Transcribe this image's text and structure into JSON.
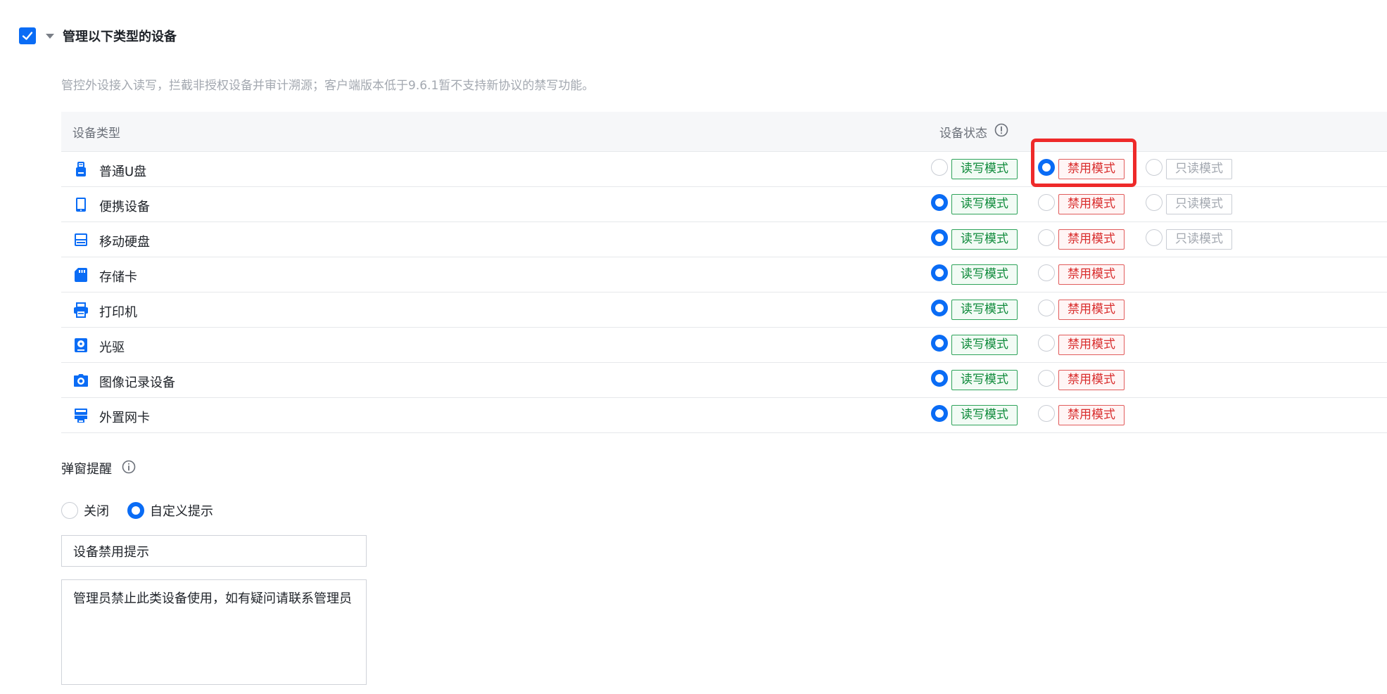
{
  "header": {
    "checked": true,
    "title": "管理以下类型的设备"
  },
  "description": "管控外设接入读写，拦截非授权设备并审计溯源；客户端版本低于9.6.1暂不支持新协议的禁写功能。",
  "table": {
    "col_type": "设备类型",
    "col_status": "设备状态",
    "status_info_icon": "exclamation-circle-icon",
    "mode_labels": {
      "read_write": "读写模式",
      "disabled": "禁用模式",
      "read_only": "只读模式"
    },
    "rows": [
      {
        "label": "普通U盘",
        "icon": "usb-drive-icon",
        "selected": "disabled",
        "has_read_only": true
      },
      {
        "label": "便携设备",
        "icon": "portable-device-icon",
        "selected": "read_write",
        "has_read_only": true
      },
      {
        "label": "移动硬盘",
        "icon": "external-hard-drive-icon",
        "selected": "read_write",
        "has_read_only": true
      },
      {
        "label": "存储卡",
        "icon": "memory-card-icon",
        "selected": "read_write",
        "has_read_only": false
      },
      {
        "label": "打印机",
        "icon": "printer-icon",
        "selected": "read_write",
        "has_read_only": false
      },
      {
        "label": "光驱",
        "icon": "optical-drive-icon",
        "selected": "read_write",
        "has_read_only": false
      },
      {
        "label": "图像记录设备",
        "icon": "camera-icon",
        "selected": "read_write",
        "has_read_only": false
      },
      {
        "label": "外置网卡",
        "icon": "network-card-icon",
        "selected": "read_write",
        "has_read_only": false
      }
    ]
  },
  "popup": {
    "label": "弹窗提醒",
    "info_icon": "info-circle-icon",
    "options": [
      {
        "label": "关闭",
        "checked": false
      },
      {
        "label": "自定义提示",
        "checked": true
      }
    ],
    "title_value": "设备禁用提示",
    "message_value": "管理员禁止此类设备使用，如有疑问请联系管理员"
  },
  "colors": {
    "accent": "#0a6cf5",
    "read_write": "#0e8a3a",
    "disabled": "#d92d2d",
    "read_only": "#a3a8b0",
    "highlight": "#ee2a2a"
  }
}
